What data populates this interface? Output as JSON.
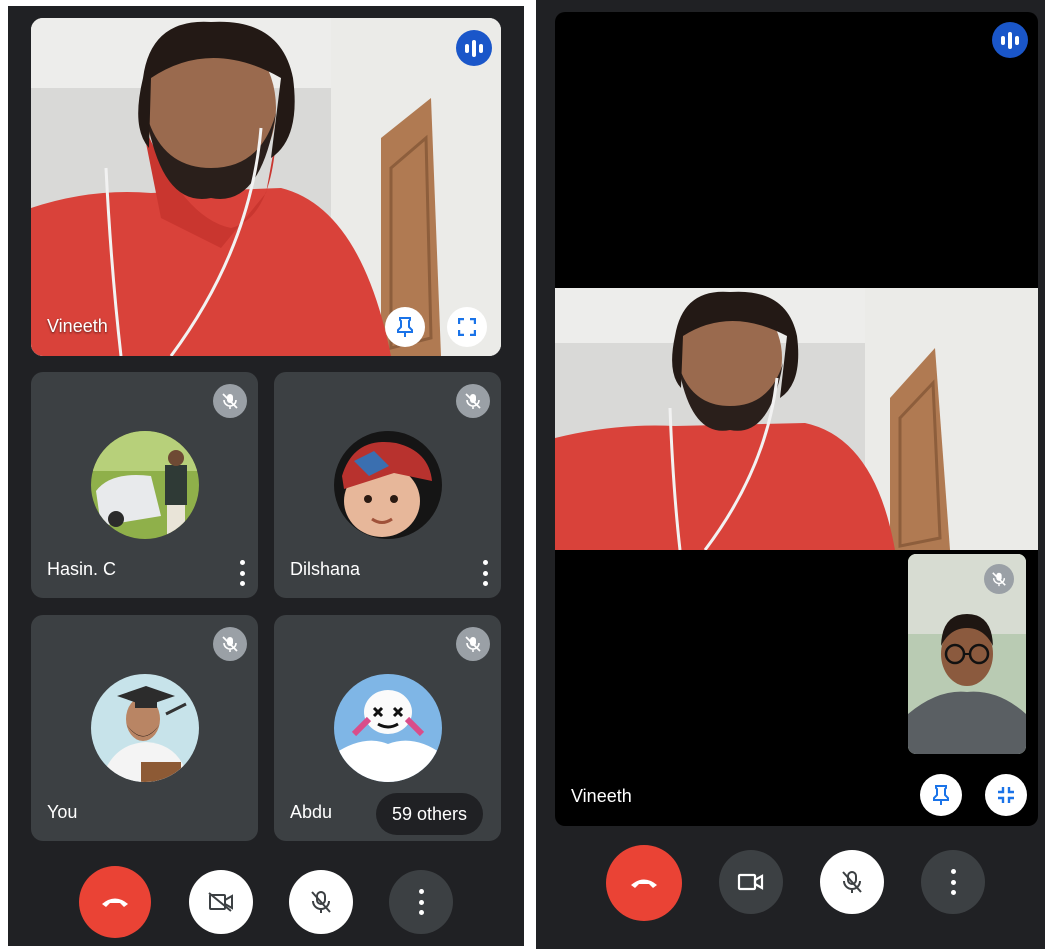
{
  "left_screen": {
    "main_tile": {
      "name": "Vineeth",
      "actions": [
        "pin-icon",
        "fullscreen-icon"
      ]
    },
    "participants": [
      {
        "name": "Hasin. C",
        "muted": true,
        "more_menu": true
      },
      {
        "name": "Dilshana",
        "muted": true,
        "more_menu": true
      },
      {
        "name": "You",
        "muted": true,
        "more_menu": false
      },
      {
        "name": "Abdu",
        "muted": true,
        "more_menu": false
      }
    ],
    "others_label": "59 others",
    "controls": [
      "end-call-icon",
      "camera-off-icon",
      "mic-off-icon",
      "more-vert-icon"
    ]
  },
  "right_screen": {
    "main_tile": {
      "name": "Vineeth",
      "actions": [
        "pin-icon",
        "exit-fullscreen-icon"
      ]
    },
    "self_view_muted": true,
    "controls": [
      "end-call-icon",
      "camera-icon",
      "mic-off-icon",
      "more-vert-icon"
    ]
  },
  "colors": {
    "background": "#202124",
    "tile": "#3c4043",
    "end_call": "#ea4335",
    "audio_indicator": "#1a56c9",
    "icon_blue": "#1a73e8"
  }
}
